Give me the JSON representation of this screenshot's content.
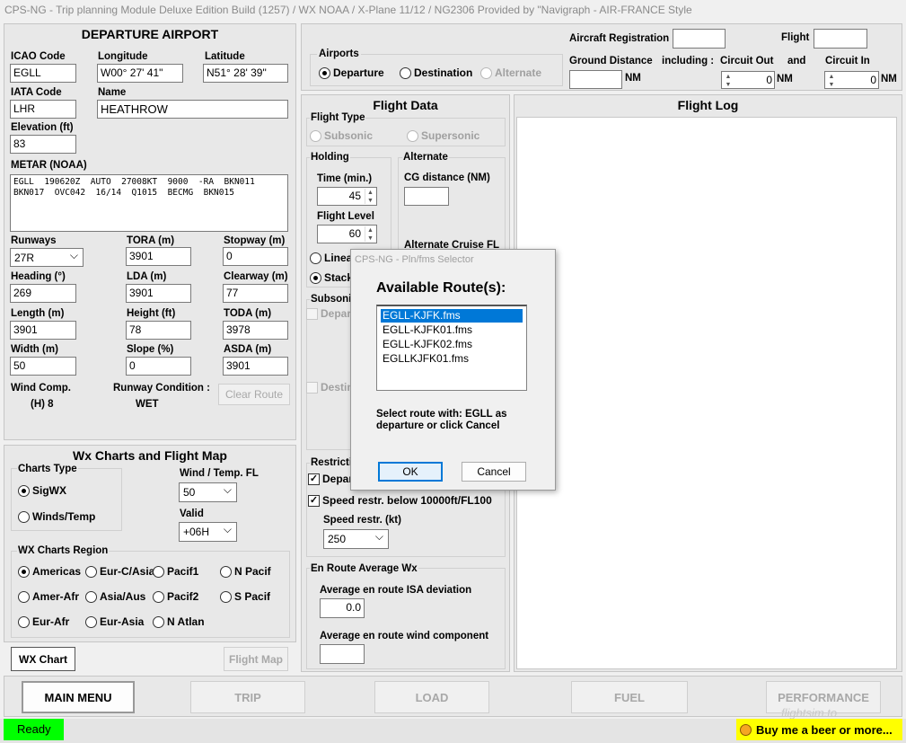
{
  "window_title": "CPS-NG - Trip planning Module  Deluxe Edition Build (1257) / WX NOAA / X-Plane 11/12 / NG2306 Provided by \"Navigraph - AIR-FRANCE Style",
  "departure": {
    "title": "DEPARTURE AIRPORT",
    "icao_label": "ICAO Code",
    "icao": "EGLL",
    "lon_label": "Longitude",
    "lon": "W00° 27' 41\"",
    "lat_label": "Latitude",
    "lat": "N51° 28' 39\"",
    "iata_label": "IATA Code",
    "iata": "LHR",
    "name_label": "Name",
    "name": "HEATHROW",
    "elev_label": "Elevation (ft)",
    "elev": "83",
    "metar_label": "METAR (NOAA)",
    "metar": "EGLL  190620Z  AUTO  27008KT  9000  -RA  BKN011\nBKN017  OVC042  16/14  Q1015  BECMG  BKN015"
  },
  "runway": {
    "runways_label": "Runways",
    "runway": "27R",
    "tora_label": "TORA (m)",
    "tora": "3901",
    "stopway_label": "Stopway (m)",
    "stopway": "0",
    "heading_label": "Heading (°)",
    "heading": "269",
    "lda_label": "LDA (m)",
    "lda": "3901",
    "clearway_label": "Clearway (m)",
    "clearway": "77",
    "length_label": "Length (m)",
    "length": "3901",
    "height_label": "Height (ft)",
    "height": "78",
    "toda_label": "TODA (m)",
    "toda": "3978",
    "width_label": "Width (m)",
    "width": "50",
    "slope_label": "Slope (%)",
    "slope": "0",
    "asda_label": "ASDA (m)",
    "asda": "3901",
    "wind_label": "Wind Comp.",
    "wind": "(H) 8",
    "cond_label": "Runway Condition :",
    "cond": "WET",
    "clear_route": "Clear Route"
  },
  "wx": {
    "title": "Wx Charts and Flight Map",
    "charts_type": "Charts Type",
    "sigwx": "SigWX",
    "winds": "Winds/Temp",
    "wind_fl_label": "Wind / Temp. FL",
    "wind_fl": "50",
    "valid_label": "Valid",
    "valid": "+06H",
    "region_label": "WX Charts Region",
    "regions": [
      "Americas",
      "Eur-C/Asia",
      "Pacif1",
      "N Pacif",
      "Amer-Afr",
      "Asia/Aus",
      "Pacif2",
      "S Pacif",
      "Eur-Afr",
      "Eur-Asia",
      "N Atlan"
    ],
    "wx_chart": "WX Chart",
    "flight_map": "Flight Map"
  },
  "airports": {
    "label": "Airports",
    "departure": "Departure",
    "destination": "Destination",
    "alternate": "Alternate"
  },
  "top": {
    "reg_label": "Aircraft Registration",
    "flight_label": "Flight",
    "ground_label": "Ground Distance",
    "nm": "NM",
    "including": "including :",
    "circ_out": "Circuit Out",
    "and": "and",
    "circ_in": "Circuit In",
    "out_val": "0",
    "in_val": "0"
  },
  "flight_data": {
    "title": "Flight Data",
    "type_label": "Flight Type",
    "subsonic": "Subsonic",
    "supersonic": "Supersonic",
    "holding": "Holding",
    "time_label": "Time (min.)",
    "time": "45",
    "fl_label": "Flight Level",
    "fl": "60",
    "linear": "Linea",
    "stack": "Stack",
    "alternate": "Alternate",
    "cg_label": "CG distance (NM)",
    "alt_cruise": "Alternate Cruise FL",
    "subsonic_grp": "Subsonic",
    "depart": "Depart",
    "destin": "Destin",
    "restrict": "Restricti",
    "depar": "Depar",
    "speed_restr": "Speed restr. below 10000ft/FL100",
    "speed_label": "Speed restr. (kt)",
    "speed": "250",
    "enroute": "En Route Average Wx",
    "isa_label": "Average en route ISA deviation",
    "isa": "0.0",
    "wind_comp_label": "Average en route wind component"
  },
  "flight_log": {
    "title": "Flight Log"
  },
  "dialog": {
    "title": "CPS-NG - Pln/fms Selector",
    "heading": "Available Route(s):",
    "routes": [
      "EGLL-KJFK.fms",
      "EGLL-KJFK01.fms",
      "EGLL-KJFK02.fms",
      "EGLLKJFK01.fms"
    ],
    "message": "Select route with: EGLL as\ndeparture or click Cancel",
    "ok": "OK",
    "cancel": "Cancel"
  },
  "bottom": {
    "main_menu": "MAIN MENU",
    "trip": "TRIP",
    "load": "LOAD",
    "fuel": "FUEL",
    "performance": "PERFORMANCE"
  },
  "status": {
    "ready": "Ready",
    "beer": "Buy me a beer or more...",
    "watermark": "flightsim.to"
  },
  "colors": {
    "ready_bg": "#00ff00",
    "beer_bg": "#ffff00",
    "selection": "#0078d7"
  }
}
